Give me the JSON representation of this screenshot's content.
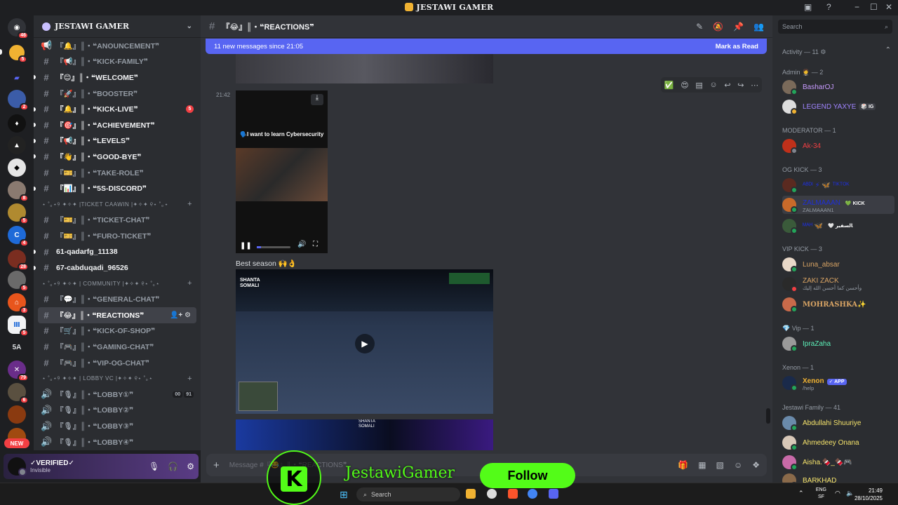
{
  "window": {
    "title": "JESTAWI GAMER",
    "controls": [
      "−",
      "☐",
      "✕"
    ]
  },
  "servers": {
    "badges": [
      "46",
      "5",
      "2",
      "8",
      "5",
      "4",
      "28",
      "5",
      "3",
      "5",
      "79",
      "6"
    ],
    "label_5a": "5A",
    "new_label": "NEW"
  },
  "guild": {
    "name": "JESTAWI GAMER",
    "channels": [
      {
        "label": "・❝ANOUNCEMENT❞",
        "prefix": "『🔔』║"
      },
      {
        "label": "・❝KICK-FAMILY❞",
        "prefix": "『📢』║"
      },
      {
        "label": "・❝WELCOME❞",
        "prefix": "『😊』║"
      },
      {
        "label": "・❝BOOSTER❞",
        "prefix": "『🚀』║"
      },
      {
        "label": "・❝KICK-LIVE❞",
        "prefix": "『🔔』║",
        "mention": "5"
      },
      {
        "label": "・❝ACHIEVEMENT❞",
        "prefix": "『🎯』║"
      },
      {
        "label": "・❝LEVELS❞",
        "prefix": "『📢』║"
      },
      {
        "label": "・❝GOOD-BYE❞",
        "prefix": "『👋』║"
      },
      {
        "label": "・❝TAKE-ROLE❞",
        "prefix": "『🎫』║"
      },
      {
        "label": "・❝5S-DISCORD❞",
        "prefix": "『📊』║"
      }
    ],
    "cat_ticket": "⋆ ˚｡⋆୨ ✦✧✦ |TICKET CAAWIN |✦✧✦ ୧⋆ ˚｡⋆",
    "ticket_channels": [
      {
        "label": "・❝TICKET-CHAT❞",
        "prefix": "『🎫』║"
      },
      {
        "label": "・❝FURO-TICKET❞",
        "prefix": "『🎫』║"
      }
    ],
    "plain_channels": [
      "61-qadarfg_11138",
      "67-cabduqadi_96526"
    ],
    "cat_community": "⋆ ˚｡⋆୨ ✦✧✦ | COMMUNITY |✦✧✦ ୧⋆ ˚｡⋆",
    "community_channels": [
      {
        "label": "・❝GENERAL-CHAT❞",
        "prefix": "『💬』║"
      },
      {
        "label": "・❝REACTIONS❞",
        "prefix": "『😂』║"
      },
      {
        "label": "・❝KICK-OF-SHOP❞",
        "prefix": "『🛒』║"
      },
      {
        "label": "・❝GAMING-CHAT❞",
        "prefix": "『🎮』║"
      },
      {
        "label": "・❝VIP-OG-CHAT❞",
        "prefix": "『🎮』║"
      }
    ],
    "cat_lobby": "⋆ ˚｡⋆୨ ✦✧✦ | LOBBY VC |✦✧✦ ୧⋆ ˚｡⋆",
    "lobby_channels": [
      {
        "label": "・❝LOBBY①❞",
        "prefix": "『🎙』║",
        "count_a": "00",
        "count_b": "91"
      },
      {
        "label": "・❝LOBBY②❞",
        "prefix": "『🎙』║"
      },
      {
        "label": "・❝LOBBY③❞",
        "prefix": "『🎙』║"
      },
      {
        "label": "・❝LOBBY④❞",
        "prefix": "『🎙』║"
      }
    ]
  },
  "user": {
    "name": "✓VERIFIED✓",
    "status": "Invisible"
  },
  "chat": {
    "channel_name": "『😂』║・❝REACTIONS❞",
    "new_messages": "11 new messages since 21:05",
    "mark_read": "Mark as Read",
    "timestamp": "21:42",
    "video_caption": "🗣️I want to learn Cybersecurity",
    "message_text": "Best season 🙌👌",
    "composer_placeholder": "Message #『😂』║・❝REACTIONS❞",
    "game_text_1": "SHANTA\nSOMALI",
    "game_text_2": "SHANTA\nSOMALI"
  },
  "members": {
    "search_placeholder": "Search",
    "activity": "Activity — 11",
    "sections": [
      {
        "title": "Admin 🤵 — 2",
        "members": [
          {
            "name": "BasharOJ",
            "color": "#c89bff",
            "status": "#23a55a"
          },
          {
            "name": "LEGEND YAXYE",
            "color": "#a084ff",
            "tag": "🎲 IG",
            "status": "#f0b232"
          }
        ]
      },
      {
        "title": "MODERATOR — 1",
        "members": [
          {
            "name": "Ak-34",
            "color": "#f23f43",
            "status": "#80848e"
          }
        ]
      },
      {
        "title": "OG KICK — 3",
        "members": [
          {
            "name": "ᴬᴮᴰᴵ ⚡ 🦋 ᵀᴵᴷᵀᴼᴷ",
            "color": "#1e2fd9",
            "status": "#23a55a"
          },
          {
            "name": "ZALMAAAN",
            "color": "#1e2fd9",
            "tag": "💚 KICK",
            "sub": "ZALMAAAN1",
            "status": "#23a55a"
          },
          {
            "name": "ᴹᴬᴴ 🦋",
            "color": "#1e2fd9",
            "tag": "🤍 ﺎﻟﺴﻔﻴﺮ",
            "status": "#23a55a"
          }
        ]
      },
      {
        "title": "VIP KICK — 3",
        "members": [
          {
            "name": "Luna_absar",
            "color": "#d9a464",
            "status": "#23a55a"
          },
          {
            "name": "ZAKI ZACK",
            "color": "#d9a464",
            "sub": "وأحسن كما أحسن الله إليك",
            "status": "#f23f43"
          },
          {
            "name": "MOHRASHKA✨",
            "color": "#d9a464",
            "status": "#23a55a"
          }
        ]
      },
      {
        "title": "💎 Vip — 1",
        "members": [
          {
            "name": "IpraZaha",
            "color": "#5cf0b8",
            "status": "#23a55a"
          }
        ]
      },
      {
        "title": "Xenon — 1",
        "members": [
          {
            "name": "Xenon",
            "color": "#f0b232",
            "tag": "✓ APP",
            "sub": "/help",
            "status": "#23a55a"
          }
        ]
      },
      {
        "title": "Jestawi Family — 41",
        "members": [
          {
            "name": "Abdullahi Shuuriye",
            "color": "#f5e36b",
            "status": "#23a55a"
          },
          {
            "name": "Ahmedeey Onana",
            "color": "#f5e36b",
            "status": "#23a55a"
          },
          {
            "name": "Aisha.🍫_🍫🎮",
            "color": "#f5e36b",
            "status": "#23a55a"
          },
          {
            "name": "BARKHAD",
            "color": "#f5e36b",
            "status": "#23a55a"
          }
        ]
      }
    ]
  },
  "overlay": {
    "kick_letter": "K",
    "channel": "JestawiGamer",
    "follow": "Follow"
  },
  "taskbar": {
    "search_placeholder": "Search",
    "lang_top": "ENG",
    "lang_bottom": "SF",
    "time": "21:49",
    "date": "28/10/2025"
  }
}
